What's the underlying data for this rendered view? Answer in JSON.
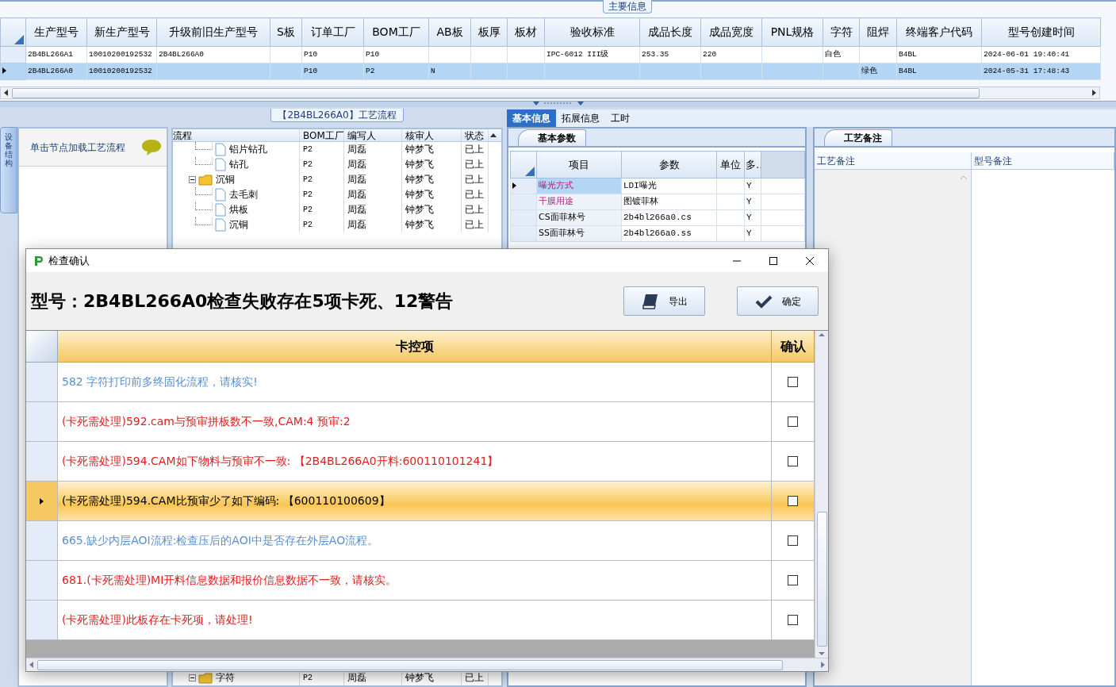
{
  "main_info": {
    "title": "主要信息",
    "columns": [
      "生产型号",
      "新生产型号",
      "升级前旧生产型号",
      "S板",
      "订单工厂",
      "BOM工厂",
      "AB板",
      "板厚",
      "板材",
      "验收标准",
      "成品长度",
      "成品宽度",
      "PNL规格",
      "字符",
      "阻焊",
      "终端客户代码",
      "型号创建时间"
    ],
    "rows": [
      {
        "selected": false,
        "cells": [
          "2B4BL266A1",
          "10010200192532",
          "2B4BL266A0",
          null,
          "P10",
          "P10",
          null,
          null,
          null,
          "IPC-6012 III级",
          "253.35",
          "220",
          null,
          "白色",
          null,
          "B4BL",
          "2024-06-01 19:40:41"
        ]
      },
      {
        "selected": true,
        "cells": [
          "2B4BL266A0",
          "10010200192532",
          null,
          null,
          "P10",
          "P2",
          "N",
          null,
          null,
          null,
          null,
          null,
          null,
          null,
          "绿色",
          "B4BL",
          "2024-05-31 17:48:43"
        ]
      }
    ]
  },
  "side_tab": {
    "label": "设备结构"
  },
  "node_panel": {
    "hint": "单击节点加载工艺流程"
  },
  "flow": {
    "title": "【2B4BL266A0】工艺流程",
    "tree_column": "流程",
    "columns": [
      "BOM工厂",
      "编写人",
      "核审人",
      "状态"
    ],
    "rows": [
      {
        "label": "铝片钻孔",
        "kind": "step",
        "cells": [
          "P2",
          "周磊",
          "钟梦飞",
          "已上"
        ]
      },
      {
        "label": "钻孔",
        "kind": "step",
        "cells": [
          "P2",
          "周磊",
          "钟梦飞",
          "已上"
        ]
      },
      {
        "label": "沉铜",
        "kind": "folder",
        "expanded": true,
        "cells": [
          "P2",
          "周磊",
          "钟梦飞",
          "已上"
        ],
        "children": [
          {
            "label": "去毛刺",
            "kind": "step",
            "cells": [
              "P2",
              "周磊",
              "钟梦飞",
              "已上"
            ]
          },
          {
            "label": "烘板",
            "kind": "step",
            "cells": [
              "P2",
              "周磊",
              "钟梦飞",
              "已上"
            ]
          },
          {
            "label": "沉铜",
            "kind": "step",
            "cells": [
              "P2",
              "周磊",
              "钟梦飞",
              "已上"
            ]
          }
        ]
      }
    ],
    "bottom_rows": [
      {
        "label": "字符",
        "kind": "folder",
        "expanded": true,
        "cells": [
          "P2",
          "周磊",
          "钟梦飞",
          "已上"
        ]
      }
    ]
  },
  "info_tabs": [
    {
      "label": "基本信息",
      "selected": true
    },
    {
      "label": "拓展信息",
      "selected": false
    },
    {
      "label": "工时",
      "selected": false
    }
  ],
  "basic_params": {
    "tab": "基本参数",
    "columns": [
      "项目",
      "参数",
      "单位",
      "多.."
    ],
    "rows": [
      {
        "selected": true,
        "emphasized": true,
        "cells": [
          "曝光方式",
          "LDI曝光",
          null,
          "Y"
        ]
      },
      {
        "selected": false,
        "emphasized": true,
        "cells": [
          "干膜用途",
          "图镀菲林",
          null,
          "Y"
        ]
      },
      {
        "selected": false,
        "emphasized": false,
        "cells": [
          "CS面菲林号",
          "2b4bl266a0.cs",
          null,
          "Y"
        ]
      },
      {
        "selected": false,
        "emphasized": false,
        "cells": [
          "SS面菲林号",
          "2b4bl266a0.ss",
          null,
          "Y"
        ]
      }
    ]
  },
  "remarks": {
    "tab": "工艺备注",
    "columns": [
      "工艺备注",
      "型号备注"
    ]
  },
  "dialog": {
    "title": "检查确认",
    "heading": "型号：2B4BL266A0检查失败存在5项卡死、12警告",
    "buttons": [
      {
        "label": "导出",
        "kind": "export"
      },
      {
        "label": "确定",
        "kind": "confirm"
      }
    ],
    "columns": [
      "卡控项",
      "确认"
    ],
    "items": [
      {
        "text": "582 字符打印前多终固化流程，请核实!",
        "kind": "warning",
        "selected": false,
        "checked": false
      },
      {
        "text": "(卡死需处理)592.cam与预审拼板数不一致,CAM:4 预审:2",
        "kind": "blocking",
        "selected": false,
        "checked": false
      },
      {
        "text": "(卡死需处理)594.CAM如下物料与预审不一致: 【2B4BL266A0开料:600110101241】",
        "kind": "blocking",
        "selected": false,
        "checked": false
      },
      {
        "text": "(卡死需处理)594.CAM比预审少了如下编码: 【600110100609】",
        "kind": "blocking",
        "selected": true,
        "checked": false
      },
      {
        "text": "665.缺少内层AOI流程:检查压后的AOI中是否存在外层AO流程。",
        "kind": "warning",
        "selected": false,
        "checked": false
      },
      {
        "text": "681.(卡死需处理)MI开料信息数据和报价信息数据不一致，请核实。",
        "kind": "blocking",
        "selected": false,
        "checked": false
      },
      {
        "text": "(卡死需处理)此板存在卡死项，请处理!",
        "kind": "blocking",
        "selected": false,
        "checked": false
      }
    ]
  }
}
